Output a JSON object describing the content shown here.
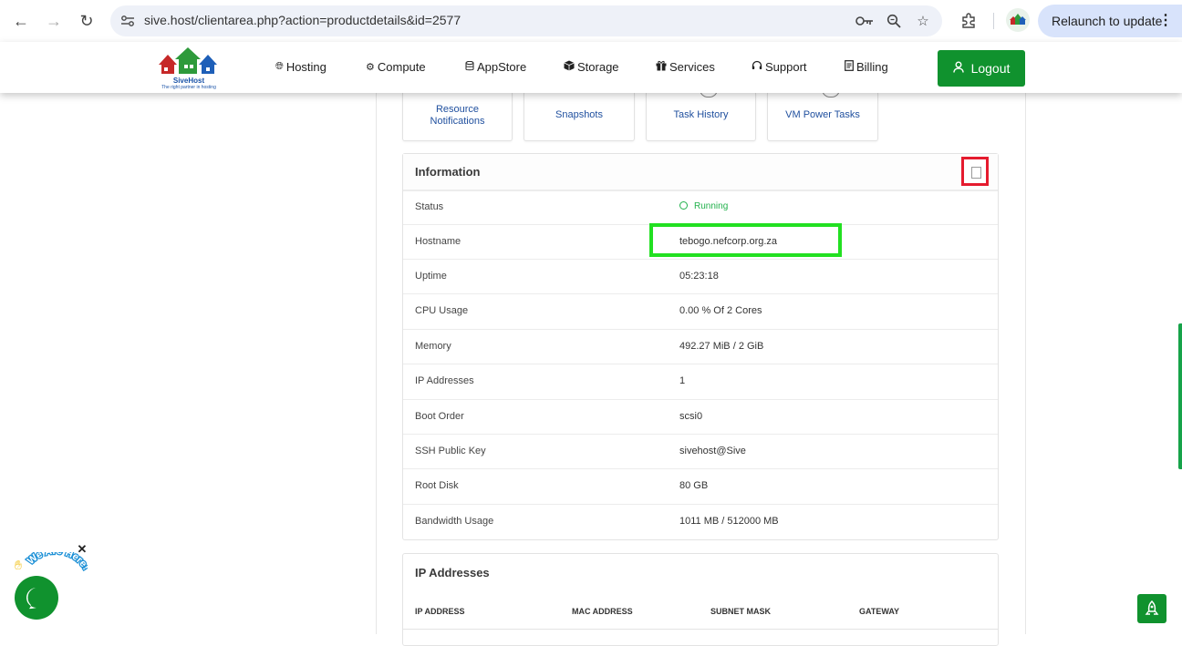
{
  "browser": {
    "url": "sive.host/clientarea.php?action=productdetails&id=2577",
    "relaunch_label": "Relaunch to update",
    "icons": [
      "back-icon",
      "forward-icon",
      "reload-icon",
      "site-info-icon",
      "password-key-icon",
      "zoom-icon",
      "bookmark-star-icon",
      "extensions-icon",
      "profile-icon",
      "menu-dots-icon"
    ]
  },
  "site": {
    "logo_brand": "SiveHost",
    "logo_tagline": "The right partner in hosting",
    "nav": [
      {
        "label": "Hosting",
        "icon": "globe-icon"
      },
      {
        "label": "Compute",
        "icon": "gear-icon"
      },
      {
        "label": "AppStore",
        "icon": "database-icon"
      },
      {
        "label": "Storage",
        "icon": "box-icon"
      },
      {
        "label": "Services",
        "icon": "gift-icon"
      },
      {
        "label": "Support",
        "icon": "headset-icon"
      },
      {
        "label": "Billing",
        "icon": "document-icon"
      }
    ],
    "logout_label": "Logout",
    "accent_color": "#10922e"
  },
  "tiles": [
    {
      "line1": "Resource",
      "line2": "Notifications"
    },
    {
      "label": "Snapshots"
    },
    {
      "label": "Task History"
    },
    {
      "label": "VM Power Tasks"
    }
  ],
  "information": {
    "title": "Information",
    "rows": [
      {
        "key": "Status",
        "value": "Running"
      },
      {
        "key": "Hostname",
        "value": "tebogo.nefcorp.org.za"
      },
      {
        "key": "Uptime",
        "value": "05:23:18"
      },
      {
        "key": "CPU Usage",
        "value": "0.00 % Of 2 Cores"
      },
      {
        "key": "Memory",
        "value": "492.27 MiB / 2 GiB"
      },
      {
        "key": "IP Addresses",
        "value": "1"
      },
      {
        "key": "Boot Order",
        "value": "scsi0"
      },
      {
        "key": "SSH Public Key",
        "value": "sivehost@Sive"
      },
      {
        "key": "Root Disk",
        "value": "80 GB"
      },
      {
        "key": "Bandwidth Usage",
        "value": "1011 MB / 512000 MB"
      }
    ]
  },
  "ip_addresses": {
    "title": "IP Addresses",
    "columns": [
      "IP ADDRESS",
      "MAC ADDRESS",
      "SUBNET MASK",
      "GATEWAY"
    ]
  },
  "chat": {
    "text": "We Are Here!",
    "close": "✕"
  }
}
